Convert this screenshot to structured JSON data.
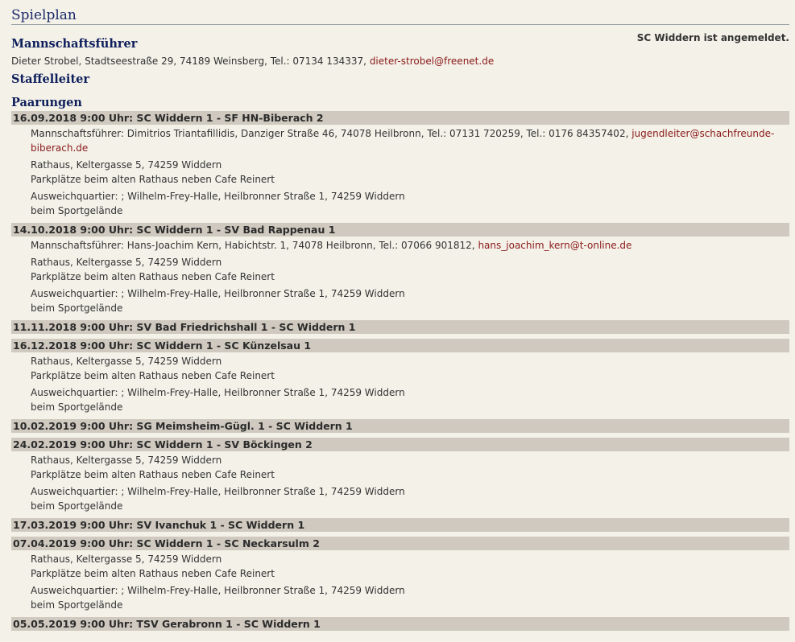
{
  "page_title": "Spielplan",
  "registration_status": "SC Widdern ist angemeldet.",
  "captain": {
    "heading": "Mannschaftsführer",
    "text": "Dieter Strobel, Stadtseestraße 29, 74189 Weinsberg, Tel.: 07134 134337, ",
    "email": "dieter-strobel@freenet.de"
  },
  "league_leader": {
    "heading": "Staffelleiter"
  },
  "pairings": {
    "heading": "Paarungen",
    "venue": {
      "address": "Rathaus, Keltergasse 5, 74259 Widdern",
      "parking": "Parkplätze beim alten Rathaus neben Cafe Reinert",
      "alternate": "Ausweichquartier: ; Wilhelm-Frey-Halle, Heilbronner Straße 1, 74259 Widdern",
      "alternate_note": "beim Sportgelände"
    },
    "matches": [
      {
        "header": "16.09.2018 9:00 Uhr: SC Widdern 1 - SF HN-Biberach 2",
        "contact_text": "Mannschaftsführer: Dimitrios Triantafillidis, Danziger Straße 46, 74078 Heilbronn, Tel.: 07131 720259, Tel.: 0176 84357402, ",
        "contact_email_1": "jugendleiter@schachfreunde-",
        "contact_email_2": "biberach.de"
      },
      {
        "header": "14.10.2018 9:00 Uhr: SC Widdern 1 - SV Bad Rappenau 1",
        "contact_text": "Mannschaftsführer: Hans-Joachim Kern, Habichtstr. 1, 74078 Heilbronn, Tel.: 07066 901812, ",
        "contact_email": "hans_joachim_kern@t-online.de"
      },
      {
        "header": "11.11.2018 9:00 Uhr: SV Bad Friedrichshall 1 - SC Widdern 1"
      },
      {
        "header": "16.12.2018 9:00 Uhr: SC Widdern 1 - SC Künzelsau 1"
      },
      {
        "header": "10.02.2019 9:00 Uhr: SG Meimsheim-Gügl. 1 - SC Widdern 1"
      },
      {
        "header": "24.02.2019 9:00 Uhr: SC Widdern 1 - SV Böckingen 2"
      },
      {
        "header": "17.03.2019 9:00 Uhr: SV Ivanchuk 1 - SC Widdern 1"
      },
      {
        "header": "07.04.2019 9:00 Uhr: SC Widdern 1 - SC Neckarsulm 2"
      },
      {
        "header": "05.05.2019 9:00 Uhr: TSV Gerabronn 1 - SC Widdern 1"
      }
    ]
  }
}
